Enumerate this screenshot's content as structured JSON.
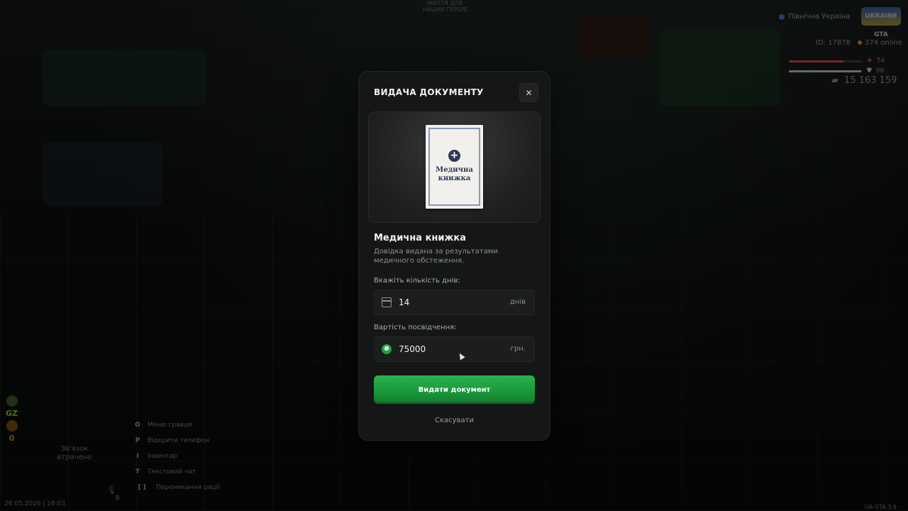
{
  "hud": {
    "region": "Північна Україна",
    "logo_text": "UKRAINE GTA",
    "player_id": "ID: 17878",
    "online": "374 online",
    "health": "74",
    "health_level": 0.74,
    "armor": "98",
    "armor_level": 0.98,
    "money": "15 163 159",
    "status_label_1": "GZ",
    "status_count": "0",
    "minimap_text": "Зв'язок втрачено",
    "keybinds": [
      {
        "key": "O",
        "label": "Меню гравця"
      },
      {
        "key": "P",
        "label": "Відкрити телефон"
      },
      {
        "key": "I",
        "label": "Інвентар"
      },
      {
        "key": "T",
        "label": "Текстовий чат"
      },
      {
        "key": "[ ]",
        "label": "Перемикання рації"
      }
    ],
    "mic_key": "B",
    "datetime": "26.05.2026 | 16:03",
    "version": "UA-GTA 3.9",
    "background_sign": "ЖИТТЯ ДЛЯ НАШИХ ГЕРОЇВ"
  },
  "modal": {
    "title": "ВИДАЧА ДОКУМЕНТУ",
    "close_icon": "close-icon",
    "document_card_title": "Медична книжка",
    "document_name": "Медична книжка",
    "document_description": "Довідка видана за результатами медичного обстеження.",
    "days_label": "Вкажіть кількість днів:",
    "days_value": "14",
    "days_unit": "днів",
    "cost_label": "Вартість посвідчення:",
    "cost_value": "75000",
    "cost_unit": "грн.",
    "submit_label": "Видати документ",
    "cancel_label": "Скасувати"
  },
  "colors": {
    "accent_green": "#1a9a3b",
    "health_red": "#d64550",
    "armor_grey": "#bfc3c3",
    "coin_green": "#19a444"
  }
}
